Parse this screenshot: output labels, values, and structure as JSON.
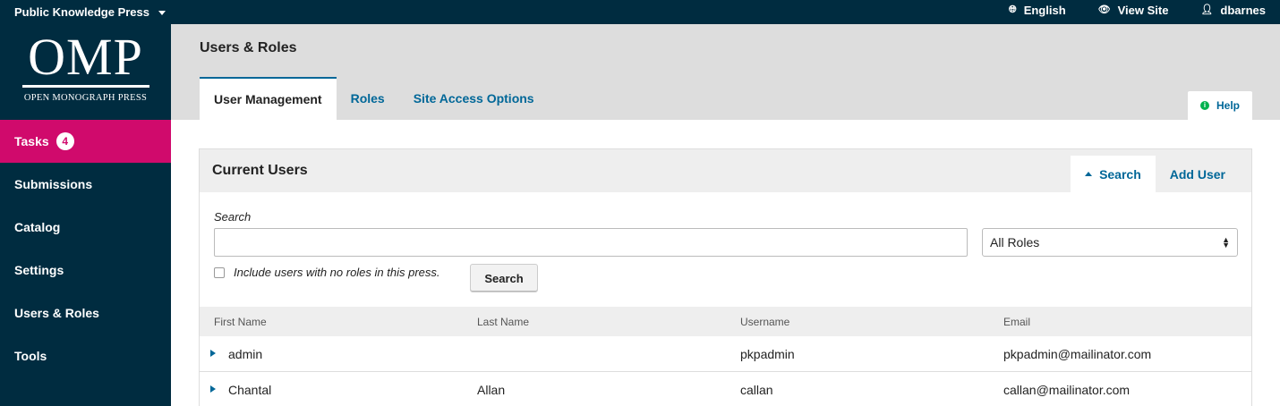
{
  "topbar": {
    "press_name": "Public Knowledge Press",
    "language": "English",
    "view_site": "View Site",
    "username": "dbarnes"
  },
  "logo": {
    "main": "OMP",
    "sub": "OPEN MONOGRAPH PRESS"
  },
  "sidebar": {
    "items": [
      {
        "label": "Tasks",
        "badge": "4"
      },
      {
        "label": "Submissions"
      },
      {
        "label": "Catalog"
      },
      {
        "label": "Settings"
      },
      {
        "label": "Users & Roles"
      },
      {
        "label": "Tools"
      }
    ]
  },
  "header": {
    "title": "Users & Roles",
    "tabs": [
      "User Management",
      "Roles",
      "Site Access Options"
    ],
    "help": "Help"
  },
  "panel": {
    "title": "Current Users",
    "actions": [
      "Search",
      "Add User"
    ],
    "search_label": "Search",
    "search_value": "",
    "roles_selected": "All Roles",
    "include_label": "Include users with no roles in this press.",
    "search_button": "Search"
  },
  "table": {
    "columns": [
      "First Name",
      "Last Name",
      "Username",
      "Email"
    ],
    "rows": [
      [
        "admin",
        "",
        "pkpadmin",
        "pkpadmin@mailinator.com"
      ],
      [
        "Chantal",
        "Allan",
        "callan",
        "callan@mailinator.com"
      ]
    ]
  },
  "colors": {
    "nav_bg": "#002c40",
    "accent_active": "#d00a6c",
    "link": "#006798",
    "help_icon": "#00b24e"
  }
}
